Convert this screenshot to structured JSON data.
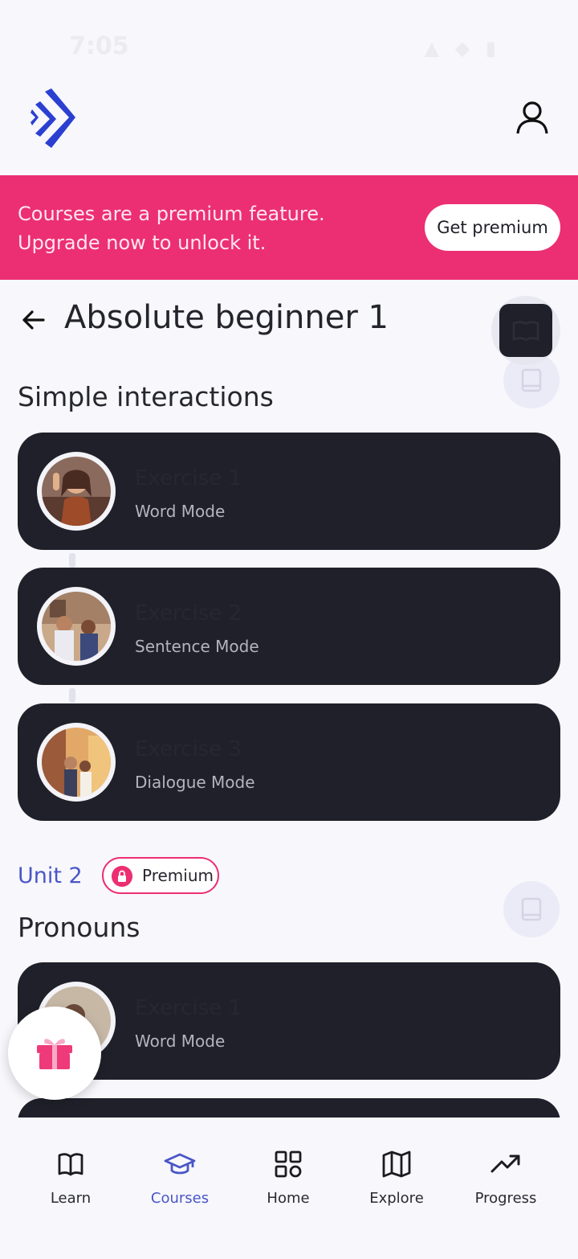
{
  "status_bar": {
    "time": "7:05",
    "icons": "▲ ◆ ▮"
  },
  "header": {
    "logo": "app-logo",
    "profile_icon": "user-icon"
  },
  "banner": {
    "text": "Courses are a premium feature. Upgrade now to unlock it.",
    "button_label": "Get premium",
    "color": "#ec2f72"
  },
  "page": {
    "title": "Absolute beginner 1"
  },
  "sections": [
    {
      "title": "Simple interactions",
      "exercises": [
        {
          "title": "Exercise 1",
          "mode": "Word Mode"
        },
        {
          "title": "Exercise 2",
          "mode": "Sentence Mode"
        },
        {
          "title": "Exercise 3",
          "mode": "Dialogue Mode"
        }
      ]
    },
    {
      "unit": "Unit 2",
      "badge": "Premium",
      "title": "Pronouns",
      "exercises": [
        {
          "title": "Exercise 1",
          "mode": "Word Mode"
        }
      ]
    }
  ],
  "nav": {
    "items": [
      {
        "label": "Learn",
        "icon": "book-open-icon"
      },
      {
        "label": "Courses",
        "icon": "graduation-cap-icon",
        "active": true
      },
      {
        "label": "Home",
        "icon": "grid-icon"
      },
      {
        "label": "Explore",
        "icon": "map-icon"
      },
      {
        "label": "Progress",
        "icon": "trend-up-icon"
      }
    ]
  },
  "colors": {
    "accent": "#4a56c7",
    "card": "#1f2029",
    "premium": "#ec2f72"
  }
}
